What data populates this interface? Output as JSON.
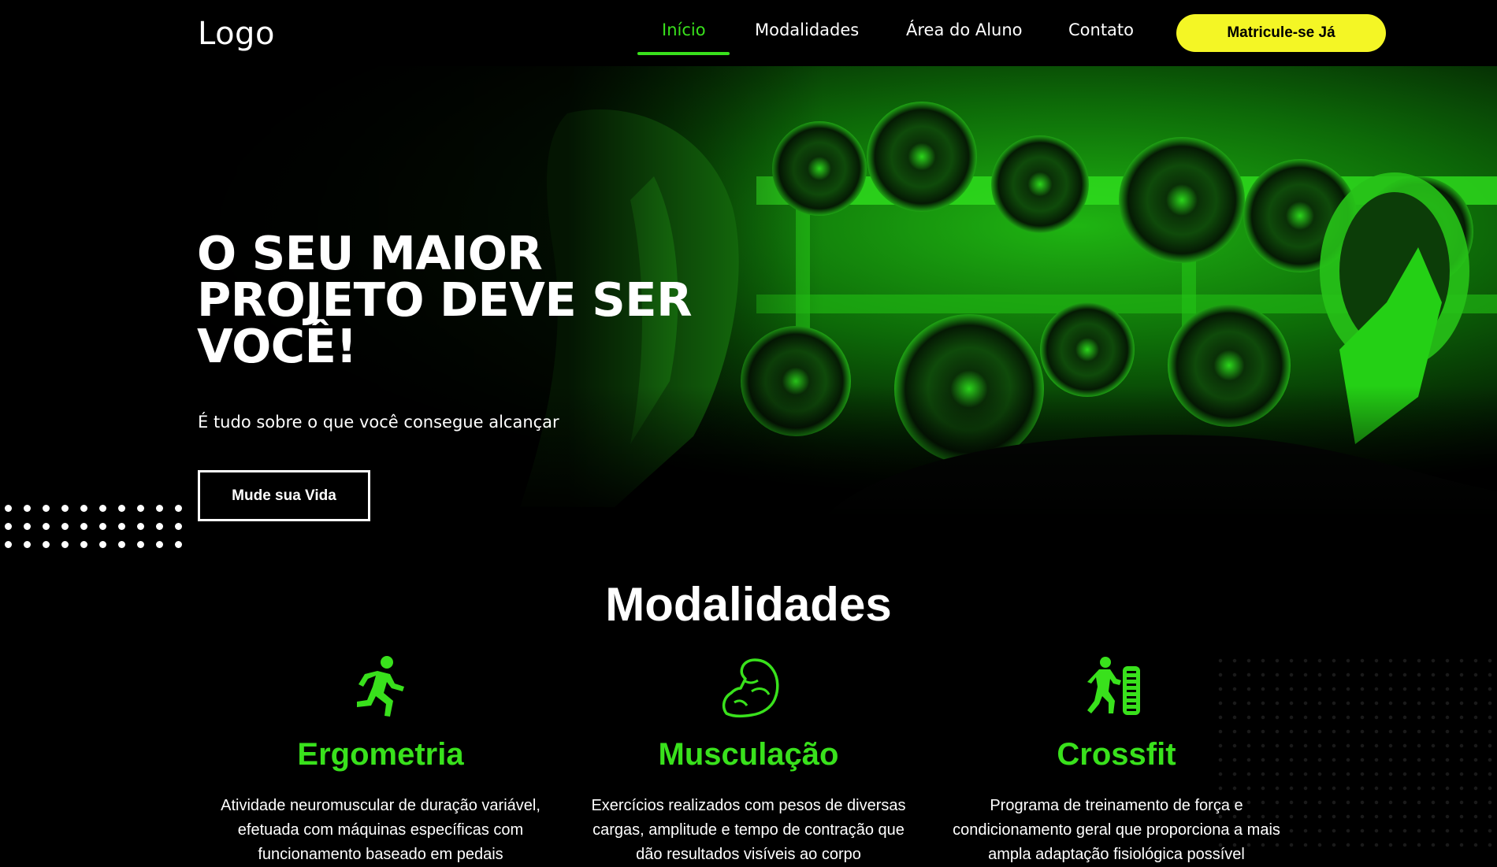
{
  "header": {
    "logo": "Logo",
    "nav": [
      {
        "label": "Início",
        "active": true
      },
      {
        "label": "Modalidades",
        "active": false
      },
      {
        "label": "Área do Aluno",
        "active": false
      },
      {
        "label": "Contato",
        "active": false
      }
    ],
    "cta_label": "Matricule-se Já"
  },
  "hero": {
    "title_lines": [
      "O SEU MAIOR",
      "PROJETO DEVE SER",
      "VOCÊ!"
    ],
    "subtitle": "É tudo sobre o que você consegue alcançar",
    "button_label": "Mude sua Vida"
  },
  "modalidades": {
    "title": "Modalidades",
    "cards": [
      {
        "icon": "running-person-icon",
        "name": "Ergometria",
        "description_lines": [
          "Atividade neuromuscular de duração variável,",
          "efetuada com máquinas específicas com",
          "funcionamento baseado em pedais"
        ]
      },
      {
        "icon": "flexed-arm-icon",
        "name": "Musculação",
        "description_lines": [
          "Exercícios realizados com pesos de diversas",
          "cargas, amplitude e tempo de contração que",
          "dão resultados visíveis ao corpo"
        ]
      },
      {
        "icon": "tire-flip-icon",
        "name": "Crossfit",
        "description_lines": [
          "Programa de treinamento de força e",
          "condicionamento geral que proporciona a mais",
          "ampla adaptação fisiológica possível"
        ]
      }
    ]
  },
  "colors": {
    "accent": "#39e11c",
    "cta": "#f4f625",
    "background": "#000000"
  }
}
